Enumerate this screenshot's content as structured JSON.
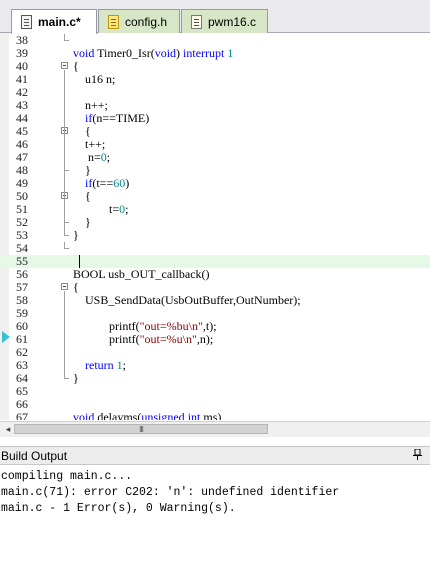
{
  "tabs": [
    {
      "label": "main.c*",
      "active": true
    },
    {
      "label": "config.h",
      "active": false
    },
    {
      "label": "pwm16.c",
      "active": false
    }
  ],
  "editor": {
    "lines": [
      {
        "num": "38",
        "code": ""
      },
      {
        "num": "39",
        "code": "void Timer0_Isr(void) interrupt 1"
      },
      {
        "num": "40",
        "code": "{"
      },
      {
        "num": "41",
        "code": "    u16 n;"
      },
      {
        "num": "42",
        "code": ""
      },
      {
        "num": "43",
        "code": "    n++;"
      },
      {
        "num": "44",
        "code": "    if(n==TIME)"
      },
      {
        "num": "45",
        "code": "    {"
      },
      {
        "num": "46",
        "code": "    t++;"
      },
      {
        "num": "47",
        "code": "     n=0;"
      },
      {
        "num": "48",
        "code": "    }"
      },
      {
        "num": "49",
        "code": "    if(t==60)"
      },
      {
        "num": "50",
        "code": "    {"
      },
      {
        "num": "51",
        "code": "            t=0;"
      },
      {
        "num": "52",
        "code": "    }"
      },
      {
        "num": "53",
        "code": "}"
      },
      {
        "num": "54",
        "code": ""
      },
      {
        "num": "55",
        "code": ""
      },
      {
        "num": "56",
        "code": "BOOL usb_OUT_callback()"
      },
      {
        "num": "57",
        "code": "{"
      },
      {
        "num": "58",
        "code": "    USB_SendData(UsbOutBuffer,OutNumber);"
      },
      {
        "num": "59",
        "code": ""
      },
      {
        "num": "60",
        "code": "            printf(\"out=%bu\\n\",t);"
      },
      {
        "num": "61",
        "code": "            printf(\"out=%u\\n\",n);"
      },
      {
        "num": "62",
        "code": ""
      },
      {
        "num": "63",
        "code": "    return 1;"
      },
      {
        "num": "64",
        "code": "}"
      },
      {
        "num": "65",
        "code": ""
      },
      {
        "num": "66",
        "code": ""
      },
      {
        "num": "67",
        "code": "void delayms(unsigned int ms)"
      }
    ]
  },
  "scrollbar": {
    "left_arrow": "◂",
    "thumb_grip": "III"
  },
  "build_output": {
    "title": "Build Output",
    "pin_icon": "pin-icon",
    "lines": [
      "compiling main.c...",
      "main.c(71): error C202: 'n': undefined identifier",
      "main.c - 1 Error(s), 0 Warning(s)."
    ]
  },
  "colors": {
    "keyword": "#0000ff",
    "type_keyword": "#7a0f9a",
    "number": "#008b8b",
    "string": "#8b0000",
    "current_line": "#e6f8e6",
    "active_tab": "#ffffff",
    "inactive_tab": "#d8e6c8"
  }
}
